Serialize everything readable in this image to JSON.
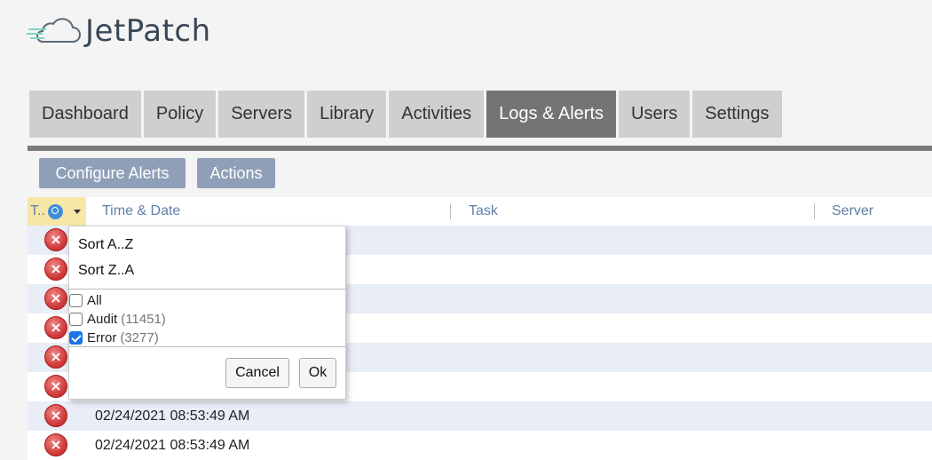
{
  "logo": {
    "text": "JetPatch"
  },
  "tabs": [
    {
      "label": "Dashboard",
      "active": false
    },
    {
      "label": "Policy",
      "active": false
    },
    {
      "label": "Servers",
      "active": false
    },
    {
      "label": "Library",
      "active": false
    },
    {
      "label": "Activities",
      "active": false
    },
    {
      "label": "Logs & Alerts",
      "active": true
    },
    {
      "label": "Users",
      "active": false
    },
    {
      "label": "Settings",
      "active": false
    }
  ],
  "toolbar": {
    "configure_label": "Configure Alerts",
    "actions_label": "Actions"
  },
  "table": {
    "columns": {
      "type": "T..",
      "time": "Time & Date",
      "task": "Task",
      "server": "Server"
    },
    "rows": [
      {
        "icon": "error-icon",
        "time": ""
      },
      {
        "icon": "error-icon",
        "time": ""
      },
      {
        "icon": "error-icon",
        "time": ""
      },
      {
        "icon": "error-icon",
        "time": ""
      },
      {
        "icon": "error-icon",
        "time": ""
      },
      {
        "icon": "error-icon",
        "time": ""
      },
      {
        "icon": "error-icon",
        "time": "02/24/2021 08:53:49 AM"
      },
      {
        "icon": "error-icon",
        "time": "02/24/2021 08:53:49 AM"
      }
    ]
  },
  "filter_popup": {
    "sort_az": "Sort A..Z",
    "sort_za": "Sort Z..A",
    "options": [
      {
        "label": "All",
        "count": "",
        "checked": false
      },
      {
        "label": "Audit",
        "count": "(11451)",
        "checked": false
      },
      {
        "label": "Error",
        "count": "(3277)",
        "checked": true
      }
    ],
    "cancel_label": "Cancel",
    "ok_label": "Ok"
  },
  "colors": {
    "active_tab": "#747474",
    "tab": "#cfcfcf",
    "button": "#8f9fb8",
    "row_alt": "#e8edf6",
    "header_highlight": "#f6e7a6"
  }
}
